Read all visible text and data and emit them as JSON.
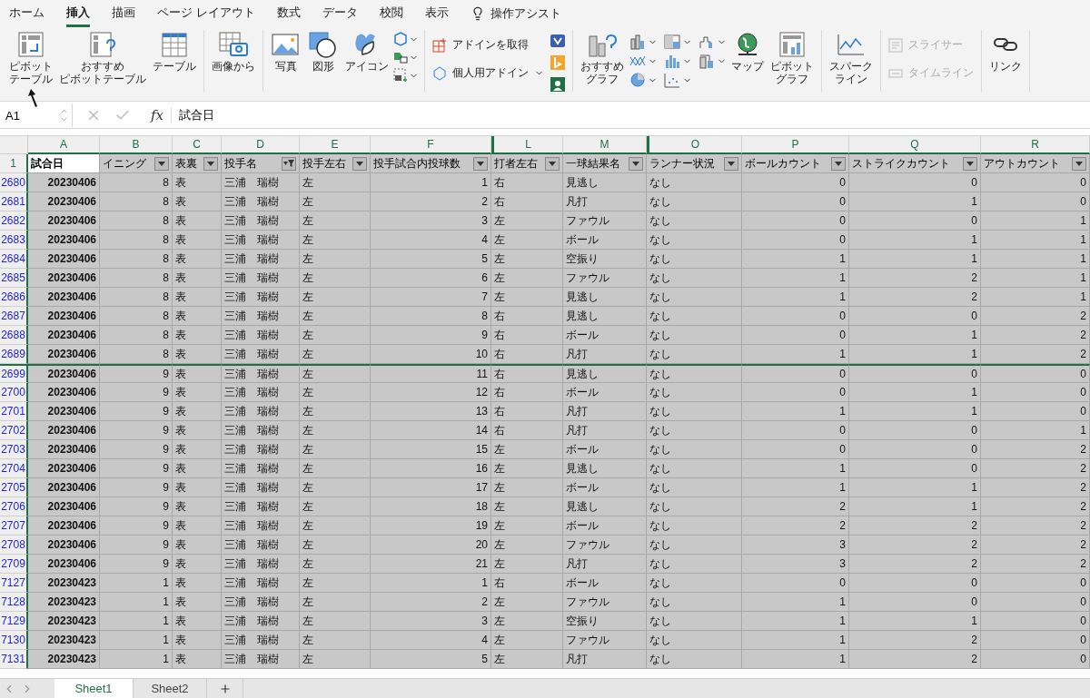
{
  "menu_tabs": [
    {
      "label": "ホーム",
      "selected": false
    },
    {
      "label": "挿入",
      "selected": true
    },
    {
      "label": "描画",
      "selected": false
    },
    {
      "label": "ページ レイアウト",
      "selected": false
    },
    {
      "label": "数式",
      "selected": false
    },
    {
      "label": "データ",
      "selected": false
    },
    {
      "label": "校閲",
      "selected": false
    },
    {
      "label": "表示",
      "selected": false
    }
  ],
  "tell_me": "操作アシスト",
  "ribbon": {
    "groups": [
      {
        "buttons": [
          {
            "lines": [
              "ピボット",
              "テーブル"
            ],
            "kind": "large"
          },
          {
            "lines": [
              "おすすめ",
              "ピボットテーブル"
            ],
            "kind": "large"
          },
          {
            "lines": [
              "テーブル"
            ],
            "kind": "large"
          }
        ]
      },
      {
        "buttons": [
          {
            "lines": [
              "画像から"
            ],
            "kind": "large"
          }
        ]
      },
      {
        "buttons": [
          {
            "lines": [
              "写真"
            ],
            "kind": "large"
          },
          {
            "lines": [
              "図形"
            ],
            "kind": "large"
          },
          {
            "lines": [
              "アイコン"
            ],
            "kind": "large"
          }
        ]
      },
      {
        "buttons": [
          {
            "label": "アドインを取得",
            "kind": "small"
          },
          {
            "label": "個人用アドイン",
            "kind": "small"
          }
        ]
      },
      {
        "buttons": [
          {
            "lines": [
              "おすすめ",
              "グラフ"
            ],
            "kind": "large"
          },
          {
            "lines": [
              "マップ"
            ],
            "kind": "large"
          },
          {
            "lines": [
              "ピボット",
              "グラフ"
            ],
            "kind": "large"
          }
        ]
      },
      {
        "buttons": [
          {
            "lines": [
              "スパーク",
              "ライン"
            ],
            "kind": "large"
          }
        ]
      },
      {
        "buttons": [
          {
            "label": "スライサー",
            "kind": "small",
            "disabled": true
          },
          {
            "label": "タイムライン",
            "kind": "small",
            "disabled": true
          }
        ]
      },
      {
        "buttons": [
          {
            "lines": [
              "リンク"
            ],
            "kind": "large"
          }
        ]
      }
    ]
  },
  "formula_bar": {
    "name_box": "A1",
    "fx": "fx",
    "formula": "試合日"
  },
  "table": {
    "filtered": true,
    "columns": [
      {
        "letter": "A",
        "header": "試合日",
        "numeric": true,
        "bold": true,
        "active": true
      },
      {
        "letter": "B",
        "header": "イニング",
        "numeric": true
      },
      {
        "letter": "C",
        "header": "表裏",
        "numeric": false
      },
      {
        "letter": "D",
        "header": "投手名",
        "numeric": false,
        "filter_active": true
      },
      {
        "letter": "E",
        "header": "投手左右",
        "numeric": false
      },
      {
        "letter": "F",
        "header": "投手試合内投球数",
        "numeric": true
      },
      {
        "letter": "L",
        "header": "打者左右",
        "numeric": false,
        "hidden_before": true
      },
      {
        "letter": "M",
        "header": "一球結果名",
        "numeric": false
      },
      {
        "letter": "O",
        "header": "ランナー状況",
        "numeric": false,
        "hidden_before": true
      },
      {
        "letter": "P",
        "header": "ボールカウント",
        "numeric": true
      },
      {
        "letter": "Q",
        "header": "ストライクカウント",
        "numeric": true
      },
      {
        "letter": "R",
        "header": "アウトカウント",
        "numeric": true
      }
    ],
    "header_row": "1",
    "rows": [
      {
        "number": "2680",
        "cells": [
          "20230406",
          "8",
          "表",
          "三浦　瑞樹",
          "左",
          "1",
          "右",
          "見逃し",
          "なし",
          "0",
          "0",
          "0"
        ]
      },
      {
        "number": "2681",
        "cells": [
          "20230406",
          "8",
          "表",
          "三浦　瑞樹",
          "左",
          "2",
          "右",
          "凡打",
          "なし",
          "0",
          "1",
          "0"
        ]
      },
      {
        "number": "2682",
        "cells": [
          "20230406",
          "8",
          "表",
          "三浦　瑞樹",
          "左",
          "3",
          "左",
          "ファウル",
          "なし",
          "0",
          "0",
          "1"
        ]
      },
      {
        "number": "2683",
        "cells": [
          "20230406",
          "8",
          "表",
          "三浦　瑞樹",
          "左",
          "4",
          "左",
          "ボール",
          "なし",
          "0",
          "1",
          "1"
        ]
      },
      {
        "number": "2684",
        "cells": [
          "20230406",
          "8",
          "表",
          "三浦　瑞樹",
          "左",
          "5",
          "左",
          "空振り",
          "なし",
          "1",
          "1",
          "1"
        ]
      },
      {
        "number": "2685",
        "cells": [
          "20230406",
          "8",
          "表",
          "三浦　瑞樹",
          "左",
          "6",
          "左",
          "ファウル",
          "なし",
          "1",
          "2",
          "1"
        ]
      },
      {
        "number": "2686",
        "cells": [
          "20230406",
          "8",
          "表",
          "三浦　瑞樹",
          "左",
          "7",
          "左",
          "見逃し",
          "なし",
          "1",
          "2",
          "1"
        ]
      },
      {
        "number": "2687",
        "cells": [
          "20230406",
          "8",
          "表",
          "三浦　瑞樹",
          "左",
          "8",
          "右",
          "見逃し",
          "なし",
          "0",
          "0",
          "2"
        ]
      },
      {
        "number": "2688",
        "cells": [
          "20230406",
          "8",
          "表",
          "三浦　瑞樹",
          "左",
          "9",
          "右",
          "ボール",
          "なし",
          "0",
          "1",
          "2"
        ]
      },
      {
        "number": "2689",
        "cells": [
          "20230406",
          "8",
          "表",
          "三浦　瑞樹",
          "左",
          "10",
          "右",
          "凡打",
          "なし",
          "1",
          "1",
          "2"
        ]
      },
      {
        "number": "2699",
        "hidden_before": true,
        "cells": [
          "20230406",
          "9",
          "表",
          "三浦　瑞樹",
          "左",
          "11",
          "右",
          "見逃し",
          "なし",
          "0",
          "0",
          "0"
        ]
      },
      {
        "number": "2700",
        "cells": [
          "20230406",
          "9",
          "表",
          "三浦　瑞樹",
          "左",
          "12",
          "右",
          "ボール",
          "なし",
          "0",
          "1",
          "0"
        ]
      },
      {
        "number": "2701",
        "cells": [
          "20230406",
          "9",
          "表",
          "三浦　瑞樹",
          "左",
          "13",
          "右",
          "凡打",
          "なし",
          "1",
          "1",
          "0"
        ]
      },
      {
        "number": "2702",
        "cells": [
          "20230406",
          "9",
          "表",
          "三浦　瑞樹",
          "左",
          "14",
          "右",
          "凡打",
          "なし",
          "0",
          "0",
          "1"
        ]
      },
      {
        "number": "2703",
        "cells": [
          "20230406",
          "9",
          "表",
          "三浦　瑞樹",
          "左",
          "15",
          "左",
          "ボール",
          "なし",
          "0",
          "0",
          "2"
        ]
      },
      {
        "number": "2704",
        "cells": [
          "20230406",
          "9",
          "表",
          "三浦　瑞樹",
          "左",
          "16",
          "左",
          "見逃し",
          "なし",
          "1",
          "0",
          "2"
        ]
      },
      {
        "number": "2705",
        "cells": [
          "20230406",
          "9",
          "表",
          "三浦　瑞樹",
          "左",
          "17",
          "左",
          "ボール",
          "なし",
          "1",
          "1",
          "2"
        ]
      },
      {
        "number": "2706",
        "cells": [
          "20230406",
          "9",
          "表",
          "三浦　瑞樹",
          "左",
          "18",
          "左",
          "見逃し",
          "なし",
          "2",
          "1",
          "2"
        ]
      },
      {
        "number": "2707",
        "cells": [
          "20230406",
          "9",
          "表",
          "三浦　瑞樹",
          "左",
          "19",
          "左",
          "ボール",
          "なし",
          "2",
          "2",
          "2"
        ]
      },
      {
        "number": "2708",
        "cells": [
          "20230406",
          "9",
          "表",
          "三浦　瑞樹",
          "左",
          "20",
          "左",
          "ファウル",
          "なし",
          "3",
          "2",
          "2"
        ]
      },
      {
        "number": "2709",
        "cells": [
          "20230406",
          "9",
          "表",
          "三浦　瑞樹",
          "左",
          "21",
          "左",
          "凡打",
          "なし",
          "3",
          "2",
          "2"
        ]
      },
      {
        "number": "7127",
        "cells": [
          "20230423",
          "1",
          "表",
          "三浦　瑞樹",
          "左",
          "1",
          "右",
          "ボール",
          "なし",
          "0",
          "0",
          "0"
        ]
      },
      {
        "number": "7128",
        "cells": [
          "20230423",
          "1",
          "表",
          "三浦　瑞樹",
          "左",
          "2",
          "左",
          "ファウル",
          "なし",
          "1",
          "0",
          "0"
        ]
      },
      {
        "number": "7129",
        "cells": [
          "20230423",
          "1",
          "表",
          "三浦　瑞樹",
          "左",
          "3",
          "左",
          "空振り",
          "なし",
          "1",
          "1",
          "0"
        ]
      },
      {
        "number": "7130",
        "cells": [
          "20230423",
          "1",
          "表",
          "三浦　瑞樹",
          "左",
          "4",
          "左",
          "ファウル",
          "なし",
          "1",
          "2",
          "0"
        ]
      },
      {
        "number": "7131",
        "cells": [
          "20230423",
          "1",
          "表",
          "三浦　瑞樹",
          "左",
          "5",
          "左",
          "凡打",
          "なし",
          "1",
          "2",
          "0"
        ]
      }
    ]
  },
  "sheet_tabs": [
    {
      "label": "Sheet1",
      "selected": true
    },
    {
      "label": "Sheet2",
      "selected": false
    }
  ]
}
